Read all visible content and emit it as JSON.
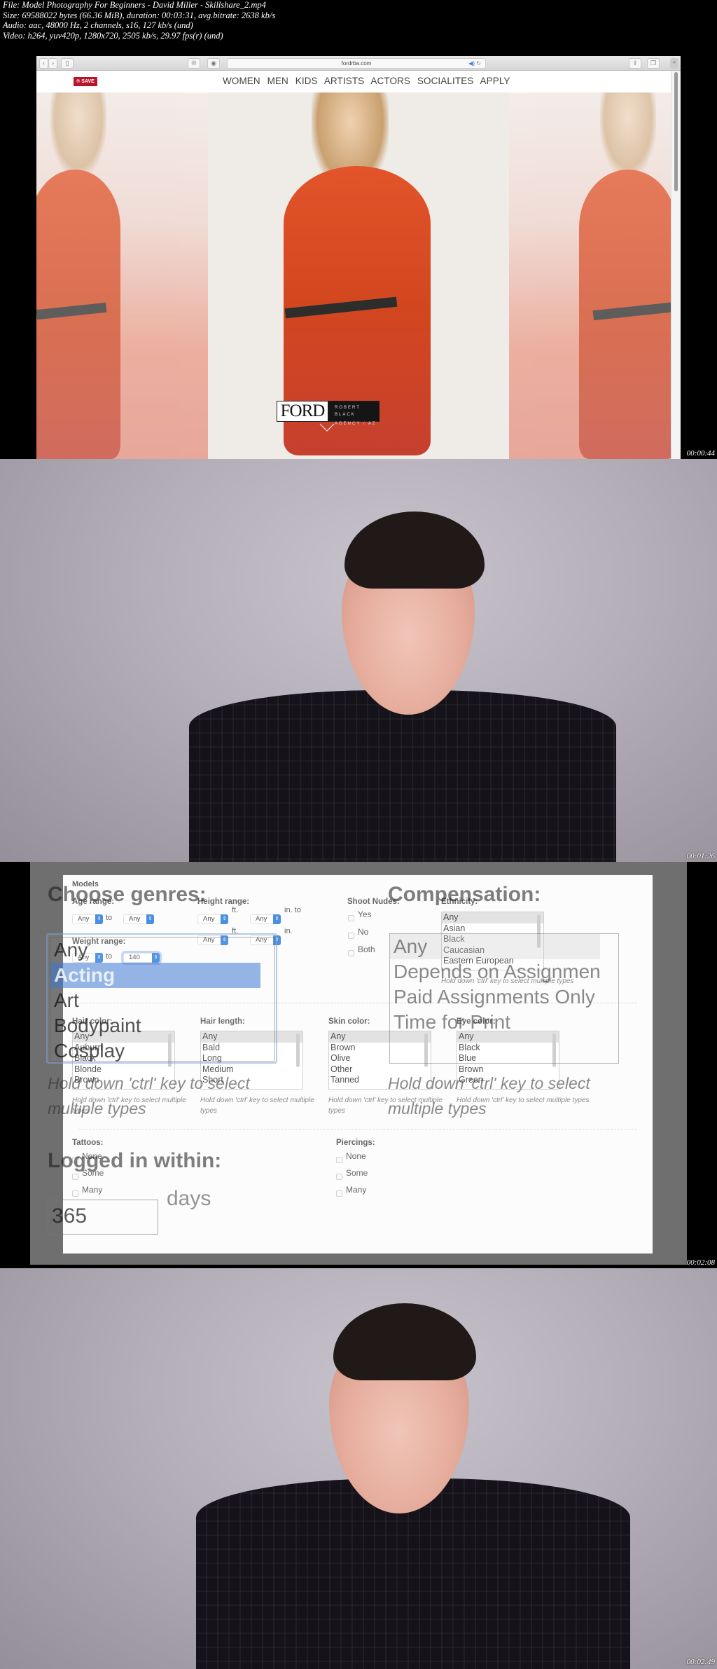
{
  "file_info": {
    "line1": "File: Model Photography For Beginners - David Miller - Skillshare_2.mp4",
    "line2": "Size: 69588022 bytes (66.36 MiB), duration: 00:03:31, avg.bitrate: 2638 kb/s",
    "line3": "Audio: aac, 48000 Hz, 2 channels, s16, 127 kb/s (und)",
    "line4": "Video: h264, yuv420p, 1280x720, 2505 kb/s, 29.97 fps(r) (und)"
  },
  "frames": [
    {
      "timestamp": "00:00:44"
    },
    {
      "timestamp": "00:01:26"
    },
    {
      "timestamp": "00:02:08"
    },
    {
      "timestamp": "00:02:49"
    }
  ],
  "browser": {
    "back_icon": "‹",
    "forward_icon": "›",
    "sidebar_icon": "▯",
    "pinterest_icon": "℗",
    "adblock_icon": "◉",
    "url": "fordrba.com",
    "audio_icon": "◀)",
    "reload_icon": "↻",
    "share_icon": "⇪",
    "tabs_icon": "❐",
    "new_tab_icon": "+"
  },
  "site": {
    "save_label": "SAVE",
    "nav": [
      "WOMEN",
      "MEN",
      "KIDS",
      "ARTISTS",
      "ACTORS",
      "SOCIALITES",
      "APPLY"
    ],
    "logo_main": "FORD",
    "logo_line1": "ROBERT BLACK",
    "logo_line2": "AGENCY / AZ",
    "accent_color": "#b8142b"
  },
  "form": {
    "section_title": "Models",
    "age_range": {
      "label": "Age range:",
      "from": "Any",
      "to_label": "to",
      "to": "Any"
    },
    "height_range": {
      "label": "Height range:",
      "from_ft": "Any",
      "ft_label": "ft.",
      "from_in": "Any",
      "in_to_label": "in. to",
      "to_ft": "Any",
      "ft_label2": "ft.",
      "to_in": "Any",
      "in_label": "in."
    },
    "weight_range": {
      "label": "Weight range:",
      "from": "Any",
      "to_label": "to",
      "to": "140"
    },
    "shoot_nudes": {
      "label": "Shoot Nudes:",
      "options": [
        "Yes",
        "No",
        "Both"
      ]
    },
    "ethnicity": {
      "label": "Ethnicity:",
      "options": [
        "Any",
        "Asian",
        "Black",
        "Caucasian",
        "Eastern European"
      ],
      "hint": "Hold down 'ctrl' key to select multiple types"
    },
    "hair_color": {
      "label": "Hair color:",
      "options": [
        "Any",
        "Auburn",
        "Black",
        "Blonde",
        "Brown"
      ],
      "hint": "Hold down 'ctrl' key to select multiple types"
    },
    "hair_length": {
      "label": "Hair length:",
      "options": [
        "Any",
        "Bald",
        "Long",
        "Medium",
        "Short"
      ],
      "hint": "Hold down 'ctrl' key to select multiple types"
    },
    "skin_color": {
      "label": "Skin color:",
      "options": [
        "Any",
        "Brown",
        "Olive",
        "Other",
        "Tanned"
      ],
      "hint": "Hold down 'ctrl' key to select multiple types"
    },
    "eye_color": {
      "label": "Eye color:",
      "options": [
        "Any",
        "Black",
        "Blue",
        "Brown",
        "Green"
      ],
      "hint": "Hold down 'ctrl' key to select multiple types"
    },
    "tattoos": {
      "label": "Tattoos:",
      "options": [
        "None",
        "Some",
        "Many"
      ]
    },
    "piercings": {
      "label": "Piercings:",
      "options": [
        "None",
        "Some",
        "Many"
      ]
    }
  },
  "ghost": {
    "genres_title": "Choose genres:",
    "genres": [
      "Any",
      "Acting",
      "Art",
      "Bodypaint",
      "Cosplay"
    ],
    "genres_selected": "Acting",
    "genres_hint": "Hold down 'ctrl' key to select multiple types",
    "compensation_title": "Compensation:",
    "compensation": [
      "Any",
      "Depends on Assignment",
      "Paid Assignments Only",
      "Time for Print"
    ],
    "compensation_hint": "Hold down 'ctrl' key to select multiple types",
    "logged_title": "Logged in within:",
    "logged_value": "365",
    "logged_unit": "days"
  }
}
